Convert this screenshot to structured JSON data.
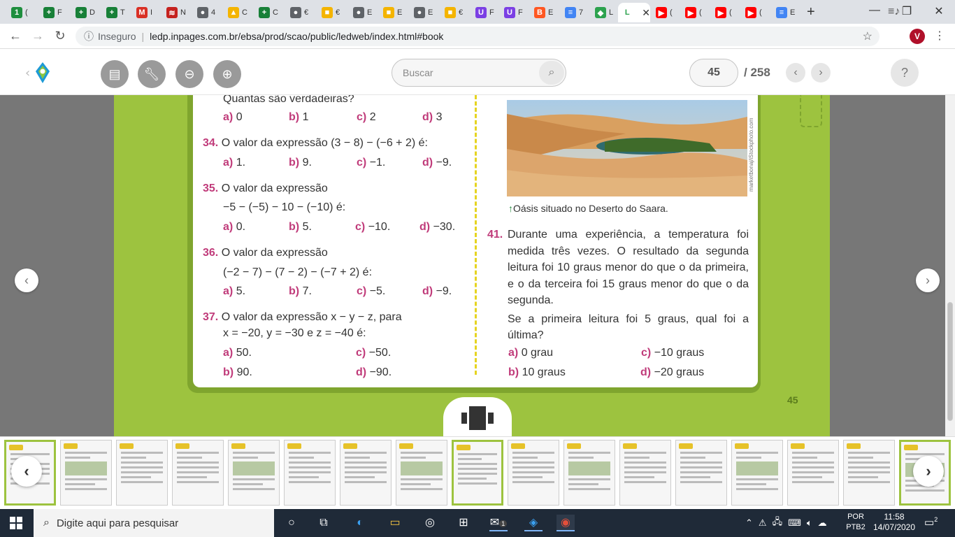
{
  "browser": {
    "tabs": [
      {
        "icon": "1",
        "label": "(",
        "color": "#1e8e3e"
      },
      {
        "icon": "+",
        "label": "F",
        "color": "#188038"
      },
      {
        "icon": "+",
        "label": "D",
        "color": "#188038"
      },
      {
        "icon": "+",
        "label": "T",
        "color": "#188038"
      },
      {
        "icon": "M",
        "label": "I",
        "color": "#d93025"
      },
      {
        "icon": "≋",
        "label": "N",
        "color": "#c5221f"
      },
      {
        "icon": "●",
        "label": "4",
        "color": "#5f6368"
      },
      {
        "icon": "▲",
        "label": "C",
        "color": "#f4b400"
      },
      {
        "icon": "+",
        "label": "C",
        "color": "#188038"
      },
      {
        "icon": "●",
        "label": "€",
        "color": "#5f6368"
      },
      {
        "icon": "■",
        "label": "€",
        "color": "#f4b400"
      },
      {
        "icon": "●",
        "label": "E",
        "color": "#5f6368"
      },
      {
        "icon": "■",
        "label": "E",
        "color": "#f4b400"
      },
      {
        "icon": "●",
        "label": "E",
        "color": "#5f6368"
      },
      {
        "icon": "■",
        "label": "€",
        "color": "#f4b400"
      },
      {
        "icon": "U",
        "label": "F",
        "color": "#7b3fe4"
      },
      {
        "icon": "U",
        "label": "F",
        "color": "#7b3fe4"
      },
      {
        "icon": "B",
        "label": "E",
        "color": "#ff5722"
      },
      {
        "icon": "≡",
        "label": "7",
        "color": "#4285f4"
      },
      {
        "icon": "◆",
        "label": "L",
        "color": "#2ca24e"
      },
      {
        "icon": "L",
        "label": "",
        "color": "#ffffff",
        "active": true
      },
      {
        "icon": "▶",
        "label": "(",
        "color": "#ff0000"
      },
      {
        "icon": "▶",
        "label": "(",
        "color": "#ff0000"
      },
      {
        "icon": "▶",
        "label": "(",
        "color": "#ff0000"
      },
      {
        "icon": "▶",
        "label": "(",
        "color": "#ff0000"
      },
      {
        "icon": "≡",
        "label": "E",
        "color": "#4285f4"
      }
    ],
    "insecure_label": "Inseguro",
    "url": "ledp.inpages.com.br/ebsa/prod/scao/public/ledweb/index.html#book",
    "profile_initial": "V"
  },
  "reader": {
    "search_placeholder": "Buscar",
    "current_page": "45",
    "total_pages": "/ 258",
    "help": "?"
  },
  "page": {
    "number": "45",
    "q33_tail": "Quantas são verdadeiras?",
    "q33_opts": [
      [
        "a)",
        "0"
      ],
      [
        "b)",
        "1"
      ],
      [
        "c)",
        "2"
      ],
      [
        "d)",
        "3"
      ]
    ],
    "q34_num": "34.",
    "q34_text": "O valor da expressão (3 − 8) − (−6 + 2) é:",
    "q34_opts": [
      [
        "a)",
        "1."
      ],
      [
        "b)",
        "9."
      ],
      [
        "c)",
        "−1."
      ],
      [
        "d)",
        "−9."
      ]
    ],
    "q35_num": "35.",
    "q35_text1": "O valor da expressão",
    "q35_text2": "−5 − (−5) − 10 − (−10) é:",
    "q35_opts": [
      [
        "a)",
        "0."
      ],
      [
        "b)",
        "5."
      ],
      [
        "c)",
        "−10."
      ],
      [
        "d)",
        "−30."
      ]
    ],
    "q36_num": "36.",
    "q36_text1": "O valor da expressão",
    "q36_text2": "(−2 − 7) − (7 − 2) − (−7 + 2) é:",
    "q36_opts": [
      [
        "a)",
        "5."
      ],
      [
        "b)",
        "7."
      ],
      [
        "c)",
        "−5."
      ],
      [
        "d)",
        "−9."
      ]
    ],
    "q37_num": "37.",
    "q37_text1": "O valor da expressão x − y − z, para",
    "q37_text2": "x = −20, y = −30 e z = −40 é:",
    "q37_opts": [
      [
        "a)",
        "50."
      ],
      [
        "c)",
        "−50."
      ],
      [
        "b)",
        "90."
      ],
      [
        "d)",
        "−90."
      ]
    ],
    "photo_credit": "marketbonaj/iStockphoto.com",
    "caption": "Oásis situado no Deserto do Saara.",
    "q41_num": "41.",
    "q41_text": "Durante uma experiência, a temperatura foi medida três vezes. O resultado da segunda leitura foi 10 graus menor do que o da primeira, e o da terceira foi 15 graus menor do que o da segunda.",
    "q41_text2": "Se a primeira leitura foi 5 graus, qual foi a última?",
    "q41_opts": [
      [
        "a)",
        "0 grau"
      ],
      [
        "c)",
        "−10 graus"
      ],
      [
        "b)",
        "10 graus"
      ],
      [
        "d)",
        "−20 graus"
      ]
    ]
  },
  "taskbar": {
    "search_placeholder": "Digite aqui para pesquisar",
    "lang1": "POR",
    "lang2": "PTB2",
    "time": "11:58",
    "date": "14/07/2020",
    "notif_count": "2",
    "mail_badge": "1"
  },
  "colors": {
    "accent_green": "#9dc33f",
    "question_pink": "#c03b7a"
  }
}
